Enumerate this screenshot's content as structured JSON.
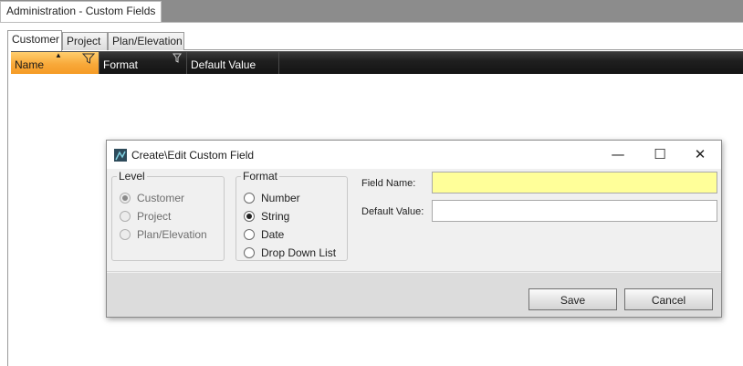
{
  "window": {
    "tab_title": "Administration - Custom Fields"
  },
  "tabs": [
    {
      "label": "Customer",
      "active": true
    },
    {
      "label": "Project",
      "active": false
    },
    {
      "label": "Plan/Elevation",
      "active": false
    }
  ],
  "grid": {
    "columns": [
      {
        "label": "Name",
        "sorted": true,
        "sort_icon": "sort-ascending-icon",
        "filter_icon": "funnel-filter-icon"
      },
      {
        "label": "Format",
        "sorted": false,
        "filter_icon": "funnel-filter-icon"
      },
      {
        "label": "Default Value",
        "sorted": false
      }
    ],
    "rows": []
  },
  "dialog": {
    "title": "Create\\Edit Custom Field",
    "app_icon": "app-icon",
    "window_buttons": {
      "minimize": "—",
      "maximize": "☐",
      "close": "✕"
    },
    "level": {
      "legend": "Level",
      "options": [
        "Customer",
        "Project",
        "Plan/Elevation"
      ],
      "selected": "Customer",
      "disabled": true
    },
    "format": {
      "legend": "Format",
      "options": [
        "Number",
        "String",
        "Date",
        "Drop Down List"
      ],
      "selected": "String"
    },
    "field_name": {
      "label": "Field Name:",
      "value": ""
    },
    "default_value": {
      "label": "Default Value:",
      "value": ""
    },
    "buttons": {
      "save": "Save",
      "cancel": "Cancel"
    }
  },
  "colors": {
    "sorted_header": "#f8a93a",
    "header_bg": "#1f1f1f",
    "required_field": "#ffff99",
    "tabstrip_bg": "#8c8c8c"
  }
}
